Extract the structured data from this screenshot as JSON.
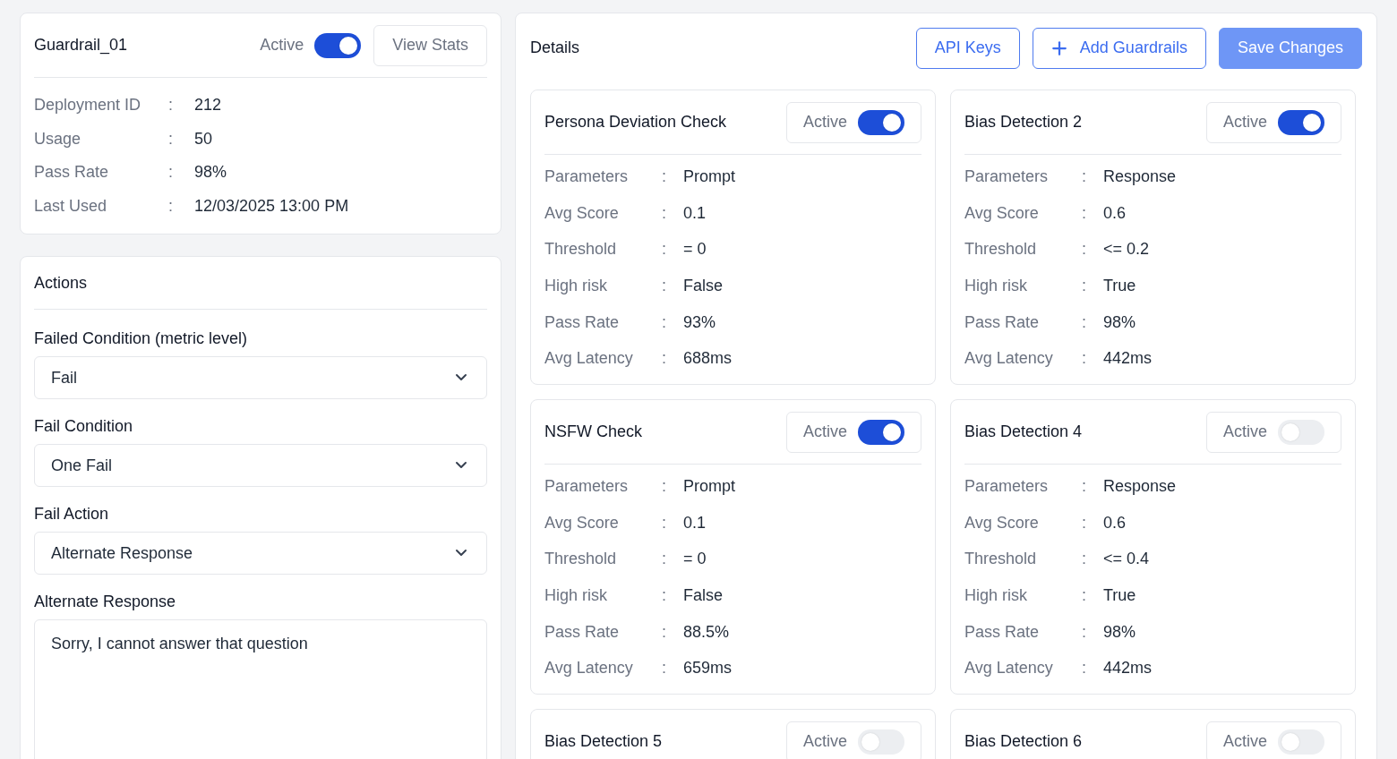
{
  "guardrail": {
    "name": "Guardrail_01",
    "toggle_label": "Active",
    "active": true,
    "view_stats": "View Stats",
    "fields": [
      {
        "label": "Deployment ID",
        "sep": ":",
        "value": "212"
      },
      {
        "label": "Usage",
        "sep": ":",
        "value": "50"
      },
      {
        "label": "Pass Rate",
        "sep": ":",
        "value": "98%"
      },
      {
        "label": "Last Used",
        "sep": ":",
        "value": "12/03/2025 13:00 PM"
      }
    ]
  },
  "actions": {
    "title": "Actions",
    "fields": [
      {
        "kind": "select",
        "label": "Failed Condition (metric level)",
        "value": "Fail"
      },
      {
        "kind": "select",
        "label": "Fail Condition",
        "value": "One Fail"
      },
      {
        "kind": "select",
        "label": "Fail Action",
        "value": "Alternate Response"
      },
      {
        "kind": "textarea",
        "label": "Alternate Response",
        "value": "Sorry, I cannot answer that question"
      }
    ]
  },
  "details": {
    "title": "Details",
    "buttons": [
      {
        "kind": "outline",
        "label": "API Keys"
      },
      {
        "kind": "add",
        "label": "Add Guardrails"
      },
      {
        "kind": "primary",
        "label": "Save Changes"
      }
    ],
    "cards": [
      {
        "name": "Persona Deviation Check",
        "toggle_label": "Active",
        "active": true,
        "fields": [
          {
            "label": "Parameters",
            "sep": ":",
            "value": "Prompt"
          },
          {
            "label": "Avg Score",
            "sep": ":",
            "value": "0.1"
          },
          {
            "label": "Threshold",
            "sep": ":",
            "value": "= 0"
          },
          {
            "label": "High risk",
            "sep": ":",
            "value": "False"
          },
          {
            "label": "Pass Rate",
            "sep": ":",
            "value": "93%"
          },
          {
            "label": "Avg Latency",
            "sep": ":",
            "value": "688ms"
          }
        ]
      },
      {
        "name": "Bias Detection 2",
        "toggle_label": "Active",
        "active": true,
        "fields": [
          {
            "label": "Parameters",
            "sep": ":",
            "value": "Response"
          },
          {
            "label": "Avg Score",
            "sep": ":",
            "value": "0.6"
          },
          {
            "label": "Threshold",
            "sep": ":",
            "value": "<= 0.2"
          },
          {
            "label": "High risk",
            "sep": ":",
            "value": "True"
          },
          {
            "label": "Pass Rate",
            "sep": ":",
            "value": "98%"
          },
          {
            "label": "Avg Latency",
            "sep": ":",
            "value": "442ms"
          }
        ]
      },
      {
        "name": "NSFW Check",
        "toggle_label": "Active",
        "active": true,
        "fields": [
          {
            "label": "Parameters",
            "sep": ":",
            "value": "Prompt"
          },
          {
            "label": "Avg Score",
            "sep": ":",
            "value": "0.1"
          },
          {
            "label": "Threshold",
            "sep": ":",
            "value": "= 0"
          },
          {
            "label": "High risk",
            "sep": ":",
            "value": "False"
          },
          {
            "label": "Pass Rate",
            "sep": ":",
            "value": "88.5%"
          },
          {
            "label": "Avg Latency",
            "sep": ":",
            "value": "659ms"
          }
        ]
      },
      {
        "name": "Bias Detection 4",
        "toggle_label": "Active",
        "active": false,
        "fields": [
          {
            "label": "Parameters",
            "sep": ":",
            "value": "Response"
          },
          {
            "label": "Avg Score",
            "sep": ":",
            "value": "0.6"
          },
          {
            "label": "Threshold",
            "sep": ":",
            "value": "<= 0.4"
          },
          {
            "label": "High risk",
            "sep": ":",
            "value": "True"
          },
          {
            "label": "Pass Rate",
            "sep": ":",
            "value": "98%"
          },
          {
            "label": "Avg Latency",
            "sep": ":",
            "value": "442ms"
          }
        ]
      },
      {
        "name": "Bias Detection 5",
        "toggle_label": "Active",
        "active": false
      },
      {
        "name": "Bias Detection 6",
        "toggle_label": "Active",
        "active": false
      }
    ]
  }
}
